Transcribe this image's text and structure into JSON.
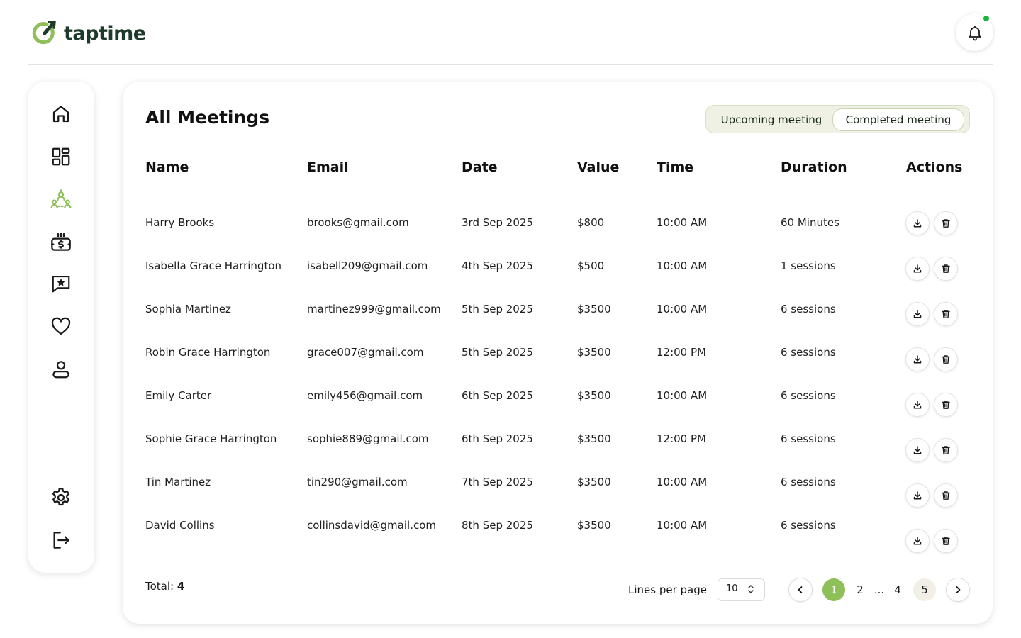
{
  "app": {
    "name": "taptime"
  },
  "colors": {
    "accent": "#8fbf58",
    "brand_dark": "#1e3a28",
    "notification_dot": "#1db538"
  },
  "header": {
    "notification_icon": "bell-icon"
  },
  "sidebar": {
    "items": [
      {
        "icon": "home-icon",
        "active": false
      },
      {
        "icon": "dashboard-icon",
        "active": false
      },
      {
        "icon": "meetings-icon",
        "active": true
      },
      {
        "icon": "payments-icon",
        "active": false
      },
      {
        "icon": "reviews-icon",
        "active": false
      },
      {
        "icon": "favorites-icon",
        "active": false
      },
      {
        "icon": "profile-icon",
        "active": false
      },
      {
        "icon": "settings-icon",
        "active": false
      },
      {
        "icon": "logout-icon",
        "active": false
      }
    ]
  },
  "main": {
    "title": "All Meetings",
    "tabs": [
      {
        "label": "Upcoming meeting",
        "active": false
      },
      {
        "label": "Completed meeting",
        "active": true
      }
    ],
    "columns": [
      "Name",
      "Email",
      "Date",
      "Value",
      "Time",
      "Duration",
      "Actions"
    ],
    "rows": [
      {
        "name": "Harry Brooks",
        "email": "brooks@gmail.com",
        "date": "3rd Sep 2025",
        "value": "$800",
        "time": "10:00 AM",
        "duration": "60 Minutes"
      },
      {
        "name": "Isabella Grace Harrington",
        "email": "isabell209@gmail.com",
        "date": "4th Sep 2025",
        "value": "$500",
        "time": "10:00 AM",
        "duration": "1 sessions"
      },
      {
        "name": "Sophia Martinez",
        "email": "martinez999@gmail.com",
        "date": "5th Sep 2025",
        "value": "$3500",
        "time": "10:00 AM",
        "duration": "6 sessions"
      },
      {
        "name": "Robin Grace Harrington",
        "email": "grace007@gmail.com",
        "date": "5th Sep 2025",
        "value": "$3500",
        "time": "12:00 PM",
        "duration": "6 sessions"
      },
      {
        "name": "Emily Carter",
        "email": "emily456@gmail.com",
        "date": "6th Sep 2025",
        "value": "$3500",
        "time": "10:00 AM",
        "duration": "6 sessions"
      },
      {
        "name": "Sophie Grace Harrington",
        "email": "sophie889@gmail.com",
        "date": "6th Sep 2025",
        "value": "$3500",
        "time": "12:00 PM",
        "duration": "6 sessions"
      },
      {
        "name": "Tin Martinez",
        "email": "tin290@gmail.com",
        "date": "7th Sep 2025",
        "value": "$3500",
        "time": "10:00 AM",
        "duration": "6 sessions"
      },
      {
        "name": "David Collins",
        "email": "collinsdavid@gmail.com",
        "date": "8th Sep 2025",
        "value": "$3500",
        "time": "10:00 AM",
        "duration": "6 sessions"
      }
    ],
    "row_actions": [
      "download-icon",
      "trash-icon"
    ]
  },
  "footer": {
    "total_label": "Total:",
    "total_value": "4",
    "lines_per_page_label": "Lines per page",
    "lines_per_page_value": "10",
    "pages": [
      "1",
      "2",
      "...",
      "4",
      "5"
    ],
    "current_page": "1"
  }
}
